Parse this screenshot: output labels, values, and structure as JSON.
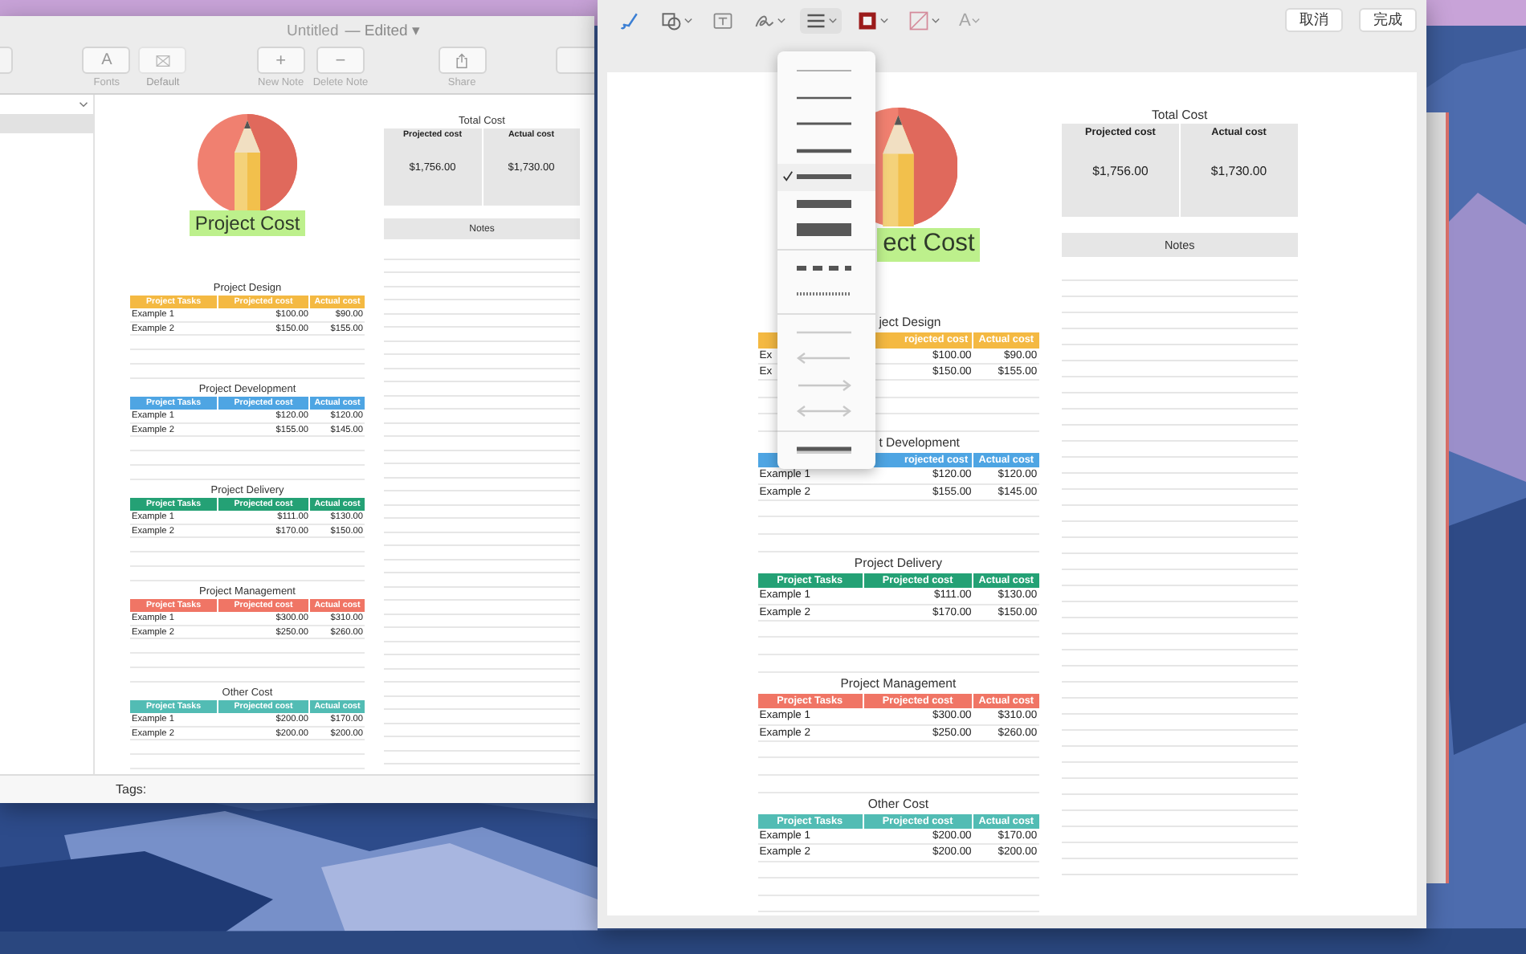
{
  "windows": [
    {
      "kind": "notes",
      "title": "Untitled",
      "status": "— Edited ▾",
      "toolbar": [
        {
          "buttons": [
            {
              "kind": "blank",
              "disabled": false
            }
          ]
        },
        {
          "buttons": [
            {
              "kind": "fonts",
              "glyph": "A",
              "label": "Fonts",
              "disabled": false
            },
            {
              "kind": "default",
              "label": "Default",
              "disabled": true
            }
          ]
        },
        {
          "buttons": [
            {
              "kind": "new",
              "glyph": "+",
              "label": "New Note",
              "disabled": false
            },
            {
              "kind": "delete",
              "glyph": "−",
              "label": "Delete Note",
              "disabled": false
            }
          ]
        },
        {
          "buttons": [
            {
              "kind": "share",
              "label": "Share",
              "disabled": false
            }
          ]
        },
        {
          "buttons": [
            {
              "kind": "blank",
              "disabled": false
            }
          ]
        }
      ],
      "sidebar": {
        "items": [
          {
            "selected": true
          }
        ]
      },
      "document": {
        "logo": {
          "label": "Project Cost",
          "kind": "full"
        },
        "sections": [
          {
            "title": "Project Design",
            "kind": "full",
            "color": "#f4b942",
            "columns": {
              "task": "Project Tasks",
              "projected": "Projected cost",
              "actual": "Actual cost"
            },
            "rows": [
              {
                "task": "Example 1",
                "projected": "$100.00",
                "actual": "$90.00"
              },
              {
                "task": "Example 2",
                "projected": "$150.00",
                "actual": "$155.00"
              }
            ]
          },
          {
            "title": "Project Development",
            "kind": "full",
            "color": "#4ea5e3",
            "columns": {
              "task": "Project Tasks",
              "projected": "Projected cost",
              "actual": "Actual cost"
            },
            "rows": [
              {
                "task": "Example 1",
                "projected": "$120.00",
                "actual": "$120.00"
              },
              {
                "task": "Example 2",
                "projected": "$155.00",
                "actual": "$145.00"
              }
            ]
          },
          {
            "title": "Project Delivery",
            "kind": "full",
            "color": "#24a175",
            "columns": {
              "task": "Project Tasks",
              "projected": "Projected cost",
              "actual": "Actual cost"
            },
            "rows": [
              {
                "task": "Example 1",
                "projected": "$111.00",
                "actual": "$130.00"
              },
              {
                "task": "Example 2",
                "projected": "$170.00",
                "actual": "$150.00"
              }
            ]
          },
          {
            "title": "Project Management",
            "kind": "full",
            "color": "#f07565",
            "columns": {
              "task": "Project Tasks",
              "projected": "Projected cost",
              "actual": "Actual cost"
            },
            "rows": [
              {
                "task": "Example 1",
                "projected": "$300.00",
                "actual": "$310.00"
              },
              {
                "task": "Example 2",
                "projected": "$250.00",
                "actual": "$260.00"
              }
            ]
          },
          {
            "title": "Other Cost",
            "kind": "full",
            "color": "#52bcb4",
            "columns": {
              "task": "Project Tasks",
              "projected": "Projected cost",
              "actual": "Actual cost"
            },
            "rows": [
              {
                "task": "Example 1",
                "projected": "$200.00",
                "actual": "$170.00"
              },
              {
                "task": "Example 2",
                "projected": "$200.00",
                "actual": "$200.00"
              }
            ]
          }
        ],
        "total": {
          "title": "Total Cost",
          "columns": [
            "Projected cost",
            "Actual cost"
          ],
          "values": [
            "$1,756.00",
            "$1,730.00"
          ]
        },
        "notes": {
          "title": "Notes"
        }
      },
      "tags_label": "Tags:"
    },
    {
      "kind": "markup",
      "tools": [
        {
          "kind": "sketch",
          "expanded": false,
          "disabled": false
        },
        {
          "kind": "shapes",
          "expanded": false,
          "disabled": false
        },
        {
          "kind": "textbox",
          "expanded": false,
          "disabled": false
        },
        {
          "kind": "sign",
          "expanded": false,
          "disabled": false
        },
        {
          "kind": "lines",
          "expanded": true,
          "disabled": false
        },
        {
          "kind": "border",
          "expanded": false,
          "disabled": false
        },
        {
          "kind": "fill",
          "expanded": false,
          "disabled": false
        },
        {
          "kind": "style",
          "glyph": "A",
          "expanded": false,
          "disabled": true
        }
      ],
      "buttons": [
        "取消",
        "完成"
      ],
      "line_menu": {
        "groups": [
          {
            "items": [
              {
                "kind": "hair",
                "selected": false
              },
              {
                "kind": "thin",
                "selected": false
              },
              {
                "kind": "light",
                "selected": false
              },
              {
                "kind": "regular",
                "selected": false
              },
              {
                "kind": "medium",
                "selected": true
              },
              {
                "kind": "bold",
                "selected": false
              },
              {
                "kind": "heavy",
                "selected": false
              }
            ]
          },
          {
            "items": [
              {
                "kind": "dashed",
                "selected": false
              },
              {
                "kind": "dotted",
                "selected": false
              }
            ]
          },
          {
            "items": [
              {
                "kind": "plain",
                "selected": false
              },
              {
                "kind": "arrowleft",
                "selected": false
              },
              {
                "kind": "arrowright",
                "selected": false
              },
              {
                "kind": "arrowboth",
                "selected": false
              }
            ]
          },
          {
            "items": [
              {
                "kind": "shadowed",
                "selected": false
              }
            ]
          }
        ]
      },
      "document": {
        "logo": {
          "label": "ect Cost",
          "kind": "clipped"
        },
        "sections": [
          {
            "title": "ject Design",
            "kind": "clipped",
            "color": "#f4b942",
            "columns": {
              "projected": "rojected cost",
              "actual": "Actual cost"
            },
            "rows": [
              {
                "task": "Ex",
                "projected": "$100.00",
                "actual": "$90.00"
              },
              {
                "task": "Ex",
                "projected": "$150.00",
                "actual": "$155.00"
              }
            ]
          },
          {
            "title": "t Development",
            "kind": "clipped",
            "color": "#4ea5e3",
            "columns": {
              "projected": "rojected cost",
              "actual": "Actual cost"
            },
            "rows": [
              {
                "task": "Example 1",
                "projected": "$120.00",
                "actual": "$120.00"
              },
              {
                "task": "Example 2",
                "projected": "$155.00",
                "actual": "$145.00"
              }
            ]
          },
          {
            "title": "Project Delivery",
            "kind": "full",
            "color": "#24a175",
            "columns": {
              "task": "Project Tasks",
              "projected": "Projected cost",
              "actual": "Actual cost"
            },
            "rows": [
              {
                "task": "Example 1",
                "projected": "$111.00",
                "actual": "$130.00"
              },
              {
                "task": "Example 2",
                "projected": "$170.00",
                "actual": "$150.00"
              }
            ]
          },
          {
            "title": "Project Management",
            "kind": "full",
            "color": "#f07565",
            "columns": {
              "task": "Project Tasks",
              "projected": "Projected cost",
              "actual": "Actual cost"
            },
            "rows": [
              {
                "task": "Example 1",
                "projected": "$300.00",
                "actual": "$310.00"
              },
              {
                "task": "Example 2",
                "projected": "$250.00",
                "actual": "$260.00"
              }
            ]
          },
          {
            "title": "Other Cost",
            "kind": "full",
            "color": "#52bcb4",
            "columns": {
              "task": "Project Tasks",
              "projected": "Projected cost",
              "actual": "Actual cost"
            },
            "rows": [
              {
                "task": "Example 1",
                "projected": "$200.00",
                "actual": "$170.00"
              },
              {
                "task": "Example 2",
                "projected": "$200.00",
                "actual": "$200.00"
              }
            ]
          }
        ],
        "total": {
          "title": "Total Cost",
          "columns": [
            "Projected cost",
            "Actual cost"
          ],
          "values": [
            "$1,756.00",
            "$1,730.00"
          ]
        },
        "notes": {
          "title": "Notes"
        }
      }
    }
  ]
}
